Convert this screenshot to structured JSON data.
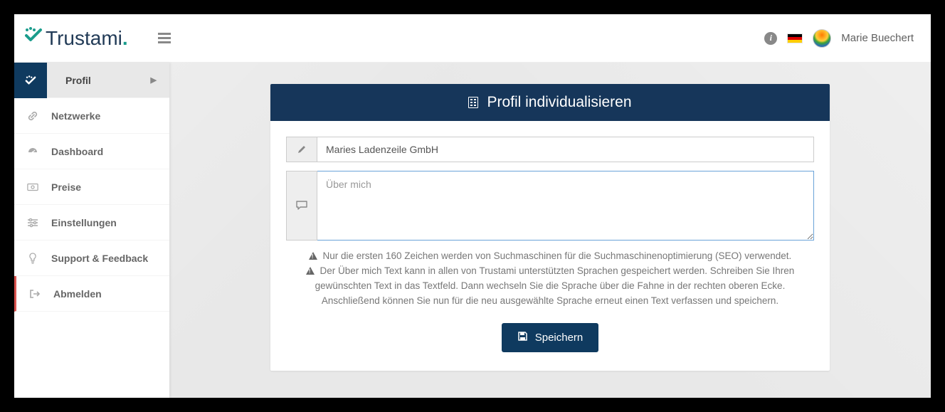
{
  "brand": {
    "name": "Trustami"
  },
  "topbar": {
    "username": "Marie Buechert"
  },
  "sidebar": {
    "items": [
      {
        "label": "Profil"
      },
      {
        "label": "Netzwerke"
      },
      {
        "label": "Dashboard"
      },
      {
        "label": "Preise"
      },
      {
        "label": "Einstellungen"
      },
      {
        "label": "Support & Feedback"
      },
      {
        "label": "Abmelden"
      }
    ]
  },
  "panel": {
    "title": "Profil individualisieren",
    "company_value": "Maries Ladenzeile GmbH",
    "about_placeholder": "Über mich",
    "hint1": "Nur die ersten 160 Zeichen werden von Suchmaschinen für die Suchmaschinenoptimierung (SEO) verwendet.",
    "hint2": "Der Über mich Text kann in allen von Trustami unterstützten Sprachen gespeichert werden. Schreiben Sie Ihren gewünschten Text in das Textfeld. Dann wechseln Sie die Sprache über die Fahne in der rechten oberen Ecke. Anschließend können Sie nun für die neu ausgewählte Sprache erneut einen Text verfassen und speichern.",
    "save_label": "Speichern"
  }
}
